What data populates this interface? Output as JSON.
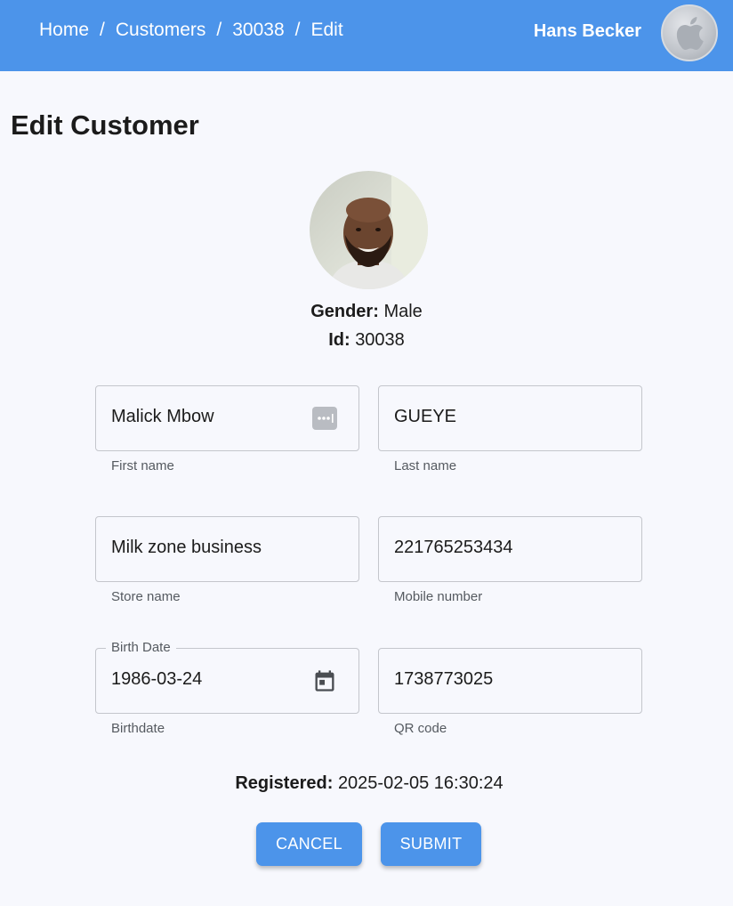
{
  "header": {
    "breadcrumb": [
      "Home",
      "Customers",
      "30038",
      "Edit"
    ],
    "separator": "/",
    "username": "Hans Becker",
    "avatar_icon": "apple-logo-icon",
    "background": "#4c94ea"
  },
  "page": {
    "title": "Edit Customer"
  },
  "profile": {
    "gender_label": "Gender:",
    "gender_value": "Male",
    "id_label": "Id:",
    "id_value": "30038"
  },
  "form": {
    "first_name": {
      "value": "Malick Mbow",
      "helper": "First name",
      "adornment_icon": "password-manager-icon"
    },
    "last_name": {
      "value": "GUEYE",
      "helper": "Last name"
    },
    "store_name": {
      "value": "Milk zone business",
      "helper": "Store name"
    },
    "mobile_number": {
      "value": "221765253434",
      "helper": "Mobile number"
    },
    "birth_date": {
      "label": "Birth Date",
      "value": "1986-03-24",
      "helper": "Birthdate",
      "adornment_icon": "calendar-icon"
    },
    "qr_code": {
      "value": "1738773025",
      "helper": "QR code"
    }
  },
  "registered": {
    "label": "Registered:",
    "value": "2025-02-05 16:30:24"
  },
  "actions": {
    "cancel_label": "CANCEL",
    "submit_label": "SUBMIT"
  }
}
